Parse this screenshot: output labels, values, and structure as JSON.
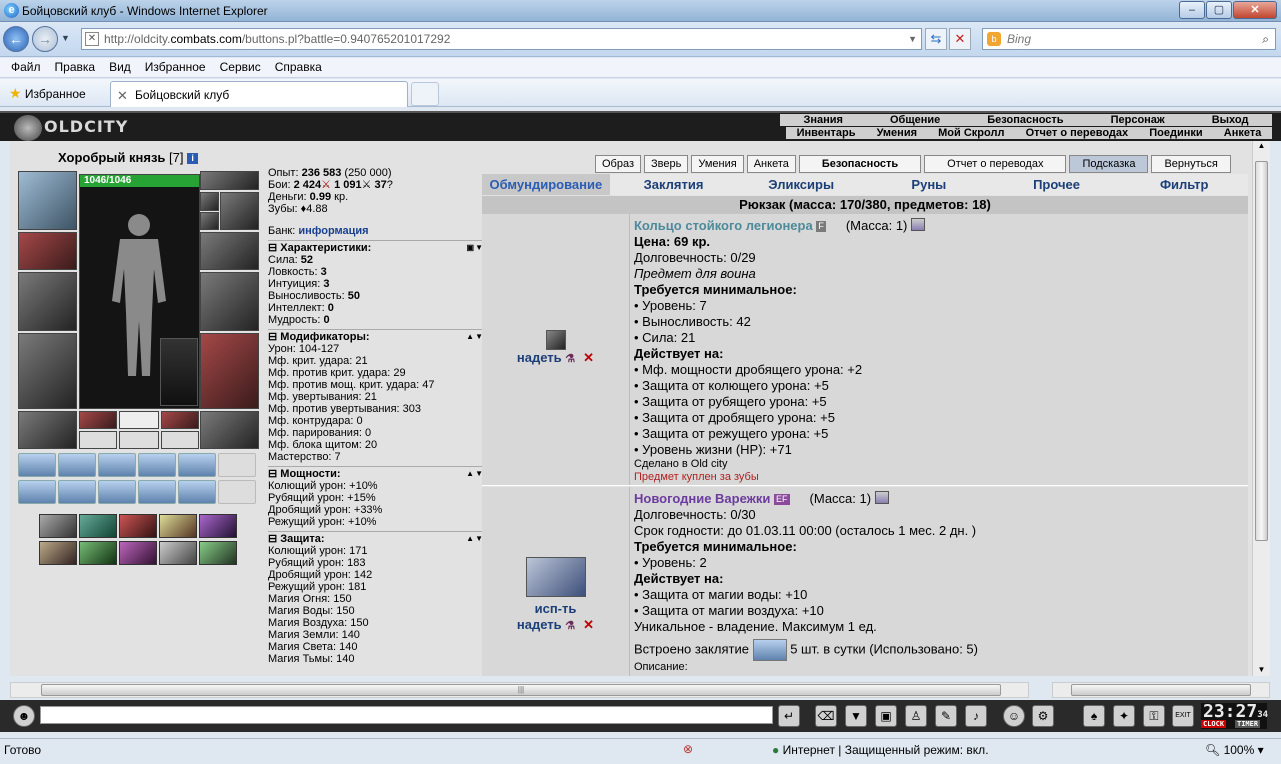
{
  "browser": {
    "title": "Бойцовский клуб - Windows Internet Explorer",
    "url_prefix": "http://oldcity.",
    "url_domain": "combats.com",
    "url_suffix": "/buttons.pl?battle=0.940765201017292",
    "search_placeholder": "Bing",
    "menu": [
      "Файл",
      "Правка",
      "Вид",
      "Избранное",
      "Сервис",
      "Справка"
    ],
    "favorites_label": "Избранное",
    "tab_title": "Бойцовский клуб",
    "status_left": "Готово",
    "status_zone": "Интернет | Защищенный режим: вкл.",
    "zoom": "100%"
  },
  "game": {
    "logo": "OLDCITY",
    "nav_top": [
      "Знания",
      "Общение",
      "Безопасность",
      "Персонаж",
      "Выход"
    ],
    "nav_bottom": [
      "Инвентарь",
      "Умения",
      "Мой Скролл",
      "Отчет о переводах",
      "Поединки",
      "Анкета"
    ],
    "top_buttons": [
      "Образ",
      "Зверь",
      "Умения",
      "Анкета",
      "Безопасность",
      "Отчет о переводах",
      "Подсказка",
      "Вернуться"
    ],
    "categories": [
      "Обмундирование",
      "Заклятия",
      "Эликсиры",
      "Руны",
      "Прочее",
      "Фильтр"
    ],
    "bag_title": "Рюкзак (масса: 170/380, предметов: 18)"
  },
  "character": {
    "name": "Хоробрый князь",
    "level": "[7]",
    "hp": "1046/1046",
    "exp_label": "Опыт:",
    "exp": "236 583",
    "exp_next": "(250 000)",
    "fights_label": "Бои:",
    "wins": "2 424",
    "losses": "1 091",
    "draws": "37",
    "money_label": "Деньги:",
    "money": "0.99",
    "money_unit": "кр.",
    "teeth_label": "Зубы:",
    "teeth": "4.88",
    "bank_label": "Банк:",
    "bank_link": "информация",
    "sections": {
      "characteristics": "Характеристики:",
      "modifiers": "Модификаторы:",
      "power": "Мощности:",
      "defense": "Защита:"
    },
    "characteristics": [
      {
        "label": "Сила:",
        "value": "52"
      },
      {
        "label": "Ловкость:",
        "value": "3"
      },
      {
        "label": "Интуиция:",
        "value": "3"
      },
      {
        "label": "Выносливость:",
        "value": "50"
      },
      {
        "label": "Интеллект:",
        "value": "0"
      },
      {
        "label": "Мудрость:",
        "value": "0"
      }
    ],
    "modifiers": [
      "Урон: 104-127",
      "Мф. крит. удара: 21",
      "Мф. против крит. удара: 29",
      "Мф. против мощ. крит. удара: 47",
      "Мф. увертывания: 21",
      "Мф. против увертывания: 303",
      "Мф. контрудара: 0",
      "Мф. парирования: 0",
      "Мф. блока щитом: 20",
      "Мастерство: 7"
    ],
    "power": [
      "Колющий урон: +10%",
      "Рубящий урон: +15%",
      "Дробящий урон: +33%",
      "Режущий урон: +10%"
    ],
    "defense": [
      "Колющий урон: 171",
      "Рубящий урон: 183",
      "Дробящий урон: 142",
      "Режущий урон: 181",
      "Магия Огня: 150",
      "Магия Воды: 150",
      "Магия Воздуха: 150",
      "Магия Земли: 140",
      "Магия Света: 140",
      "Магия Тьмы: 140"
    ]
  },
  "inventory": [
    {
      "name": "Кольцо стойкого легионера",
      "badge": "F",
      "mass": "(Масса: 1)",
      "actions": [
        "надеть"
      ],
      "lines": [
        {
          "t": "Цена: 69 кр.",
          "s": "bd"
        },
        {
          "t": "Долговечность: 0/29",
          "s": ""
        },
        {
          "t": "Предмет для воина",
          "s": "it"
        },
        {
          "t": "Требуется минимальное:",
          "s": "bd"
        },
        {
          "t": "• Уровень: 7",
          "s": ""
        },
        {
          "t": "• Выносливость: 42",
          "s": ""
        },
        {
          "t": "• Сила: 21",
          "s": ""
        },
        {
          "t": "Действует на:",
          "s": "bd"
        },
        {
          "t": "• Мф. мощности дробящего урона: +2",
          "s": ""
        },
        {
          "t": "• Защита от колющего урона: +5",
          "s": ""
        },
        {
          "t": "• Защита от рубящего урона: +5",
          "s": ""
        },
        {
          "t": "• Защита от дробящего урона: +5",
          "s": ""
        },
        {
          "t": "• Защита от режущего урона: +5",
          "s": ""
        },
        {
          "t": "• Уровень жизни (HP): +71",
          "s": ""
        },
        {
          "t": "Сделано в Old city",
          "s": "sm"
        },
        {
          "t": "Предмет куплен за зубы",
          "s": "rd"
        }
      ]
    },
    {
      "name": "Новогодние Варежки",
      "badge": "EF",
      "mass": "(Масса: 1)",
      "actions": [
        "исп-ть",
        "надеть"
      ],
      "lines": [
        {
          "t": "Долговечность: 0/30",
          "s": ""
        },
        {
          "t": "Срок годности: до 01.03.11 00:00 (осталось 1 мес. 2 дн. )",
          "s": ""
        },
        {
          "t": "Требуется минимальное:",
          "s": "bd"
        },
        {
          "t": "• Уровень: 2",
          "s": ""
        },
        {
          "t": "Действует на:",
          "s": "bd"
        },
        {
          "t": "• Защита от магии воды: +10",
          "s": ""
        },
        {
          "t": "• Защита от магии воздуха: +10",
          "s": ""
        },
        {
          "t": "Уникальное - владение. Максимум 1 ед.",
          "s": ""
        }
      ],
      "spell_prefix": "Встроено заклятие",
      "spell_suffix": "5 шт. в сутки (Использовано: 5)",
      "desc_label": "Описание:"
    }
  ],
  "clock": {
    "time": "23:27",
    "sec": "34",
    "label1": "CLOCK",
    "label2": "TIMER"
  }
}
